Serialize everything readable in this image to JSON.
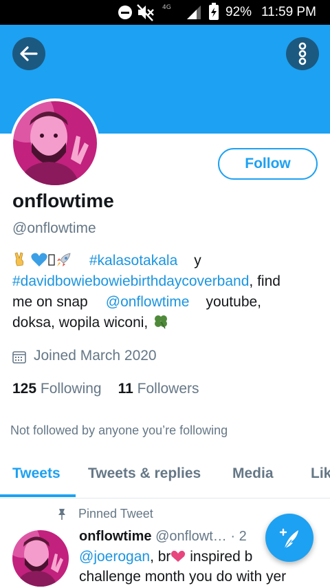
{
  "status_bar": {
    "network": "4G",
    "battery": "92%",
    "time": "11:59 PM",
    "icons": [
      "do-not-disturb-icon",
      "mute-icon",
      "signal-icon",
      "battery-charging-icon"
    ]
  },
  "header": {
    "back_icon": "arrow-left-icon",
    "more_icon": "more-vertical-icon",
    "banner_color": "#1da1f2",
    "button_color": "#1c5980"
  },
  "profile": {
    "follow_label": "Follow",
    "display_name": "onflowtime",
    "handle": "@onflowtime",
    "bio": {
      "hashtag1": "#kalasotakala",
      "text1": "y",
      "hashtag2": "#davidbowiebowiebirthdaycoverband",
      "text2": ", find",
      "text3": "me on snap",
      "mention": "@onflowtime",
      "text4": "youtube,",
      "text5": "doksa, wopila wiconi,",
      "emojis": [
        "victory-hand-icon",
        "blue-heart-icon",
        "missing-glyph-icon",
        "rocket-icon",
        "four-leaf-clover-icon"
      ]
    },
    "joined": "Joined March 2020",
    "following_count": "125",
    "following_label": "Following",
    "followers_count": "11",
    "followers_label": "Followers",
    "not_followed": "Not followed by anyone you’re following"
  },
  "tabs": [
    {
      "label": "Tweets",
      "active": true
    },
    {
      "label": "Tweets & replies",
      "active": false
    },
    {
      "label": "Media",
      "active": false
    },
    {
      "label": "Lik",
      "active": false
    }
  ],
  "tweet": {
    "pinned_label": "Pinned Tweet",
    "name": "onflowtime",
    "handle": "@onflowt…",
    "dot": "·",
    "time_partial": "2",
    "mention": "@joerogan",
    "text1": ", br",
    "text2": "inspired b",
    "text3": "challenge month you do with yer"
  },
  "fab": {
    "icon": "compose-feather-icon"
  },
  "colors": {
    "accent": "#1da1f2",
    "link": "#1b95e0",
    "secondary_text": "#657786",
    "primary_text": "#14171a"
  }
}
